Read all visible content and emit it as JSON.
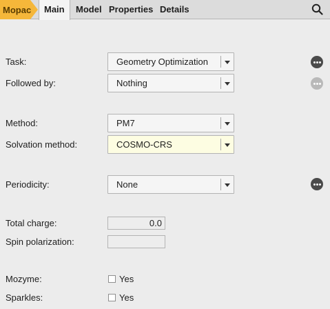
{
  "tabs": {
    "breadcrumb": "Mopac",
    "items": [
      "Main",
      "Model",
      "Properties",
      "Details"
    ],
    "active": "Main"
  },
  "icons": {
    "search": "search-icon",
    "more": "ellipsis-icon"
  },
  "colors": {
    "breadcrumb": "#f5b73a",
    "highlight_field": "#fdfde2"
  },
  "form": {
    "task": {
      "label": "Task:",
      "value": "Geometry Optimization"
    },
    "followed_by": {
      "label": "Followed by:",
      "value": "Nothing"
    },
    "method": {
      "label": "Method:",
      "value": "PM7"
    },
    "solvation": {
      "label": "Solvation method:",
      "value": "COSMO-CRS"
    },
    "periodicity": {
      "label": "Periodicity:",
      "value": "None"
    },
    "total_charge": {
      "label": "Total charge:",
      "value": "0.0"
    },
    "spin_polarization": {
      "label": "Spin polarization:",
      "value": ""
    },
    "mozyme": {
      "label": "Mozyme:",
      "option": "Yes",
      "checked": false
    },
    "sparkles": {
      "label": "Sparkles:",
      "option": "Yes",
      "checked": false
    }
  }
}
